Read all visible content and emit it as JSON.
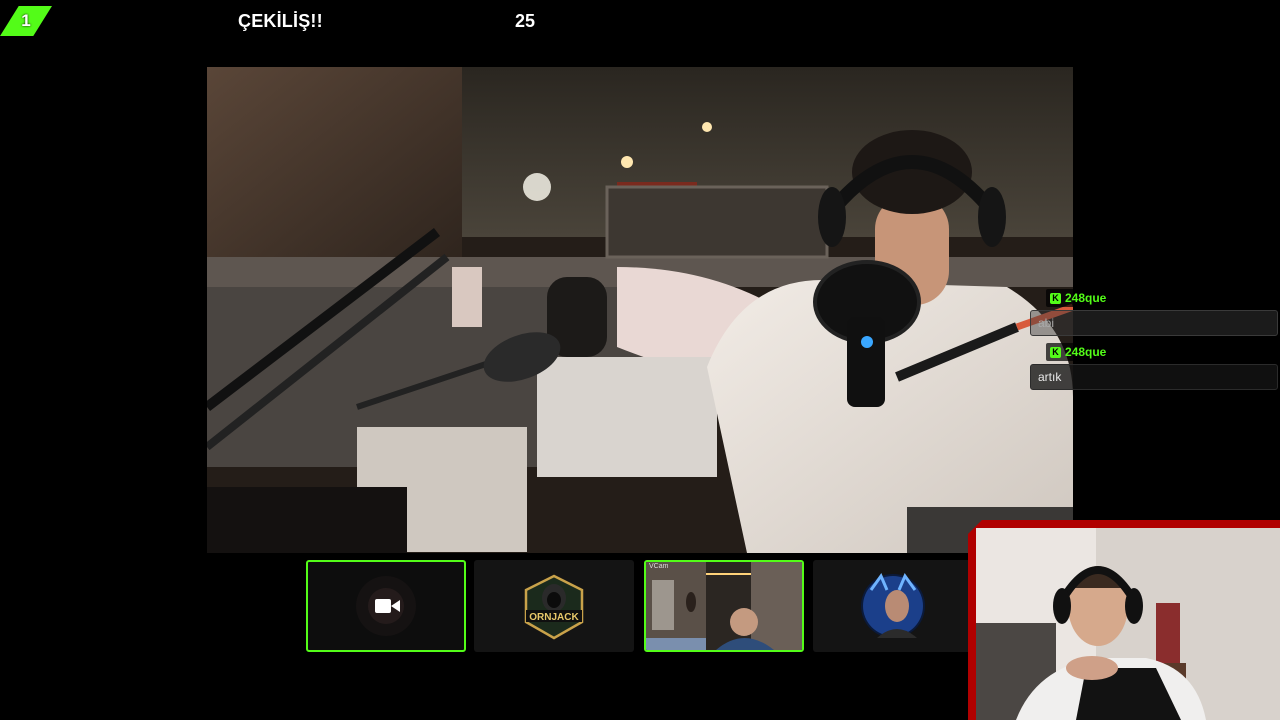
{
  "viewer_badge": {
    "count": "1"
  },
  "stream": {
    "title": "ÇEKİLİŞ!!",
    "count": "25"
  },
  "participants": [
    {
      "type": "camera-off",
      "active": true
    },
    {
      "type": "logo",
      "logo_text": "ORNJACK",
      "active": false
    },
    {
      "type": "video",
      "label": "VCam",
      "active": true
    },
    {
      "type": "avatar",
      "active": false
    }
  ],
  "chat": {
    "messages": [
      {
        "username": "248que",
        "text": "abi",
        "faded": true
      },
      {
        "username": "248que",
        "text": "artık",
        "faded": false
      }
    ]
  },
  "colors": {
    "accent": "#53fc18",
    "facecam_frame": "#b00000",
    "background": "#000000"
  },
  "icons": {
    "viewer": "kick-badge-icon",
    "chat_badge": "kick-k-icon",
    "camera_off": "video-camera-icon"
  }
}
